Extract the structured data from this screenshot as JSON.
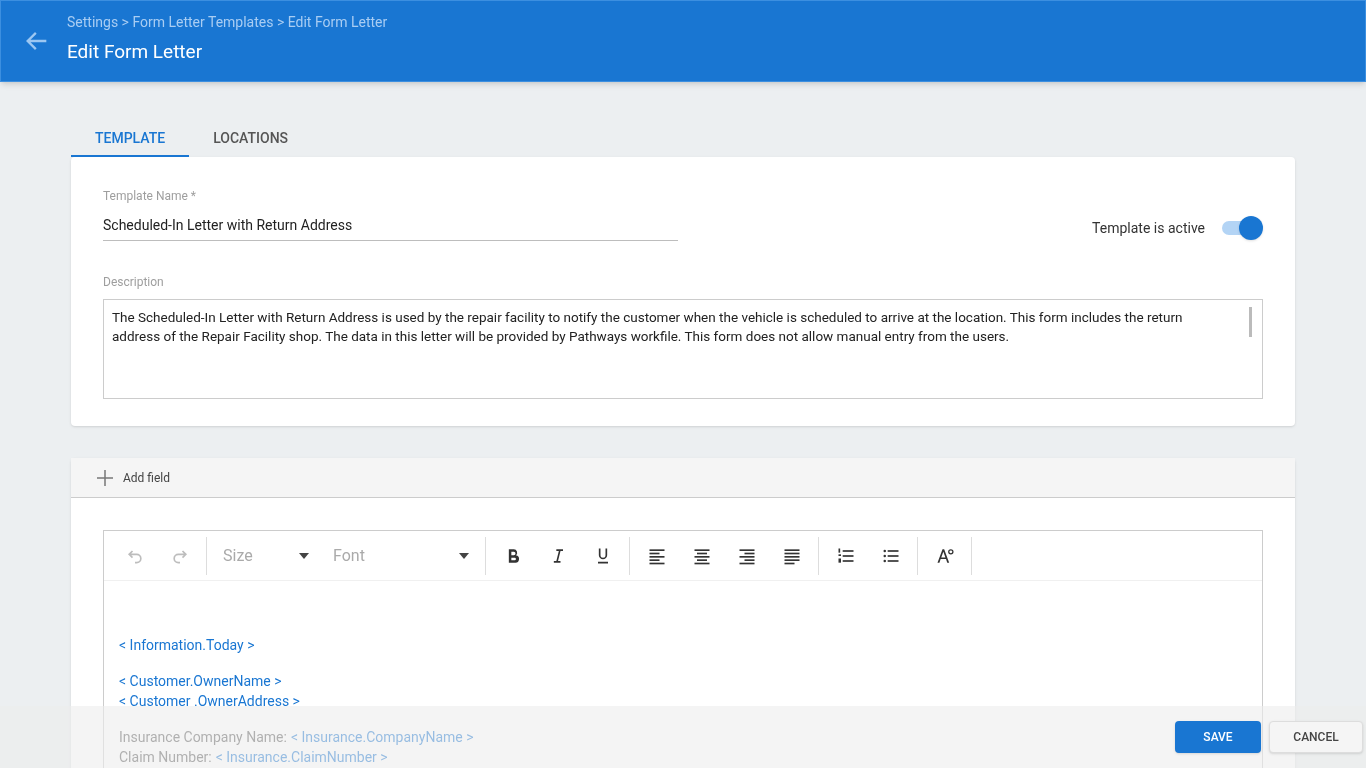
{
  "header": {
    "breadcrumb": "Settings > Form Letter Templates > Edit Form Letter",
    "title": "Edit Form Letter"
  },
  "tabs": [
    {
      "label": "TEMPLATE",
      "selected": true
    },
    {
      "label": "LOCATIONS",
      "selected": false
    }
  ],
  "template_name": {
    "label": "Template Name *",
    "value": "Scheduled-In Letter with Return Address"
  },
  "active_toggle": {
    "label": "Template is active",
    "on": true
  },
  "description": {
    "label": "Description",
    "value": "The Scheduled-In Letter with Return Address is used by the repair facility to notify the customer when the vehicle is scheduled to arrive at the location. This form includes the return address of the Repair Facility shop. The data in this letter will be provided by Pathways workfile. This form does not allow manual entry from the users."
  },
  "add_field": {
    "label": "Add field"
  },
  "toolbar": [
    {
      "kind": "undo",
      "disabled": true
    },
    {
      "kind": "redo",
      "disabled": true
    },
    {
      "kind": "separator"
    },
    {
      "kind": "select",
      "label": "Size",
      "wide": false
    },
    {
      "kind": "select",
      "label": "Font",
      "wide": true
    },
    {
      "kind": "separator"
    },
    {
      "kind": "bold"
    },
    {
      "kind": "italic"
    },
    {
      "kind": "underline"
    },
    {
      "kind": "separator"
    },
    {
      "kind": "align-left"
    },
    {
      "kind": "align-center"
    },
    {
      "kind": "align-right"
    },
    {
      "kind": "justify"
    },
    {
      "kind": "separator"
    },
    {
      "kind": "ordered-list"
    },
    {
      "kind": "bullet-list"
    },
    {
      "kind": "separator"
    },
    {
      "kind": "text-color"
    },
    {
      "kind": "separator"
    }
  ],
  "letter_paragraphs": [
    [
      {
        "field": "< Information.Today >"
      }
    ],
    [
      {
        "field": "< Customer.OwnerName >"
      },
      {
        "field": "< Customer .OwnerAddress >"
      }
    ],
    [
      {
        "label": "Insurance Company Name:",
        "field": "< Insurance.CompanyName >"
      },
      {
        "label": "Claim Number:",
        "field": "< Insurance.ClaimNumber >"
      }
    ]
  ],
  "actions": [
    {
      "label": "SAVE",
      "kind": "primary"
    },
    {
      "label": "CANCEL",
      "kind": "secondary"
    }
  ]
}
